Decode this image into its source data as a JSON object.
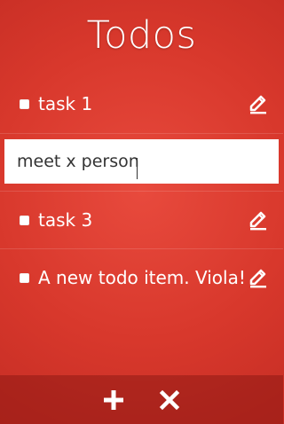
{
  "header": {
    "title": "Todos"
  },
  "todos": [
    {
      "label": "task 1",
      "checked": false
    },
    {
      "label": "meet x person",
      "editing": true
    },
    {
      "label": "task 3",
      "checked": false
    },
    {
      "label": "A new todo item. Viola!",
      "checked": false
    }
  ],
  "toolbar": {
    "add_icon": "plus-icon",
    "close_icon": "close-icon"
  },
  "colors": {
    "background": "#d8382c",
    "bottom_bar": "#b12a22",
    "text": "#ffffff"
  }
}
